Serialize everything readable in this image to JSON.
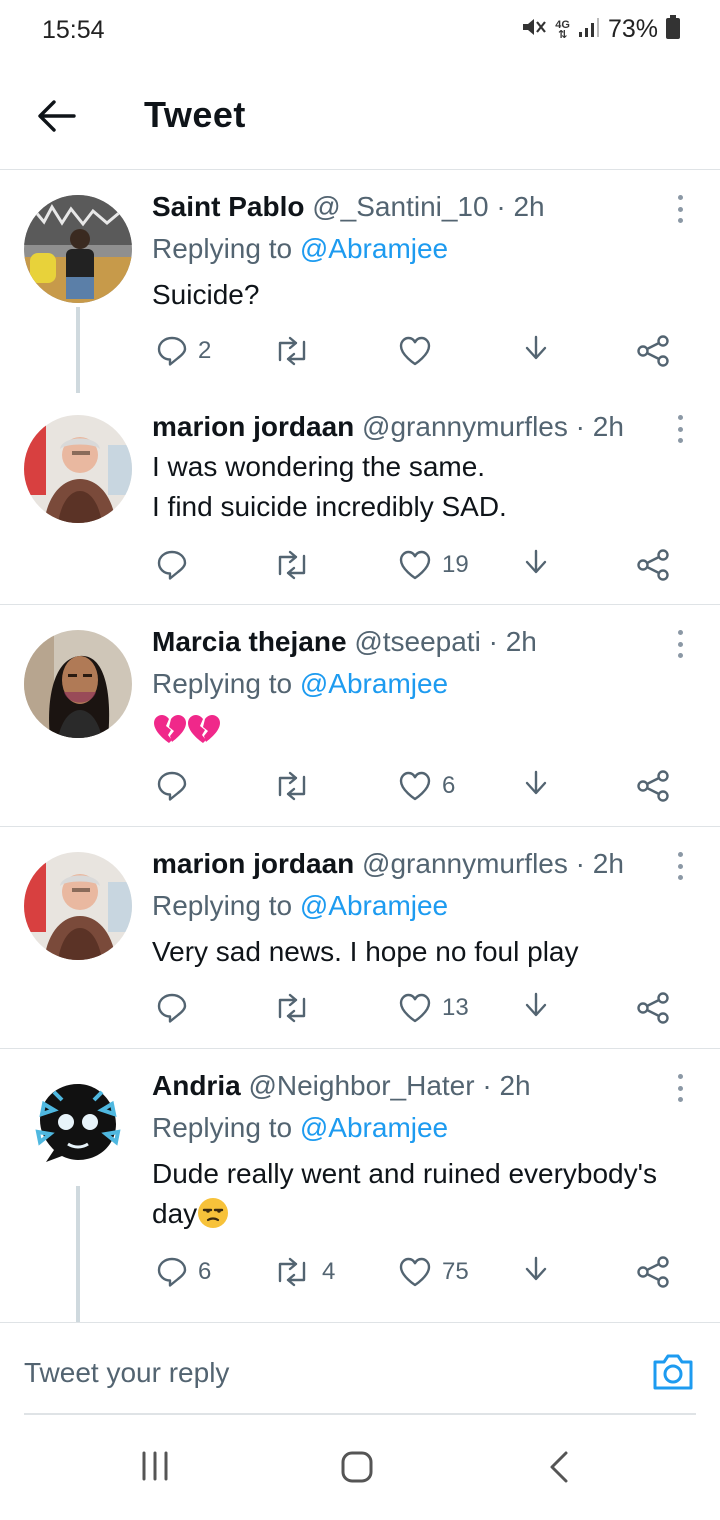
{
  "status_bar": {
    "time": "15:54",
    "network": "4G",
    "battery": "73%",
    "icons": [
      "mute-icon",
      "network-4g-icon",
      "signal-icon",
      "battery-icon"
    ]
  },
  "header": {
    "title": "Tweet",
    "back_icon": "back-arrow-icon"
  },
  "tweets": [
    {
      "name": "Saint Pablo",
      "handle": "@_Santini_10",
      "time": "· 2h",
      "replying_label": "Replying to",
      "replying_to": "@Abramjee",
      "text": "Suicide?",
      "replies": "2",
      "retweets": "",
      "likes": ""
    },
    {
      "name": "marion jordaan",
      "handle": "@grannymurfles",
      "time": "· 2h",
      "text_lines": [
        "I was wondering the same.",
        "I find suicide incredibly SAD."
      ],
      "replies": "",
      "retweets": "",
      "likes": "19"
    },
    {
      "name": "Marcia thejane",
      "handle": "@tseepati",
      "time": "· 2h",
      "replying_label": "Replying to",
      "replying_to": "@Abramjee",
      "text_emoji": "broken-heart-emoji x2",
      "replies": "",
      "retweets": "",
      "likes": "6"
    },
    {
      "name": "marion jordaan",
      "handle": "@grannymurfles",
      "time": "· 2h",
      "replying_label": "Replying to",
      "replying_to": "@Abramjee",
      "text": "Very sad news. I hope no foul play",
      "replies": "",
      "retweets": "",
      "likes": "13"
    },
    {
      "name": "Andria",
      "handle": "@Neighbor_Hater",
      "time": "· 2h",
      "replying_label": "Replying to",
      "replying_to": "@Abramjee",
      "text_line1": "Dude really went and ruined everybody's",
      "text_line2": "day",
      "text_emoji": "unamused-face-emoji",
      "replies": "6",
      "retweets": "4",
      "likes": "75"
    }
  ],
  "reply_bar": {
    "placeholder": "Tweet your reply",
    "camera_icon": "camera-icon"
  },
  "nav_bar": {
    "icons": [
      "recent-apps-icon",
      "home-icon",
      "nav-back-icon"
    ]
  },
  "colors": {
    "accent": "#1d9bf0",
    "secondary_text": "#536471",
    "divider": "#dfe3e6",
    "thread_line": "#cfd9de"
  }
}
